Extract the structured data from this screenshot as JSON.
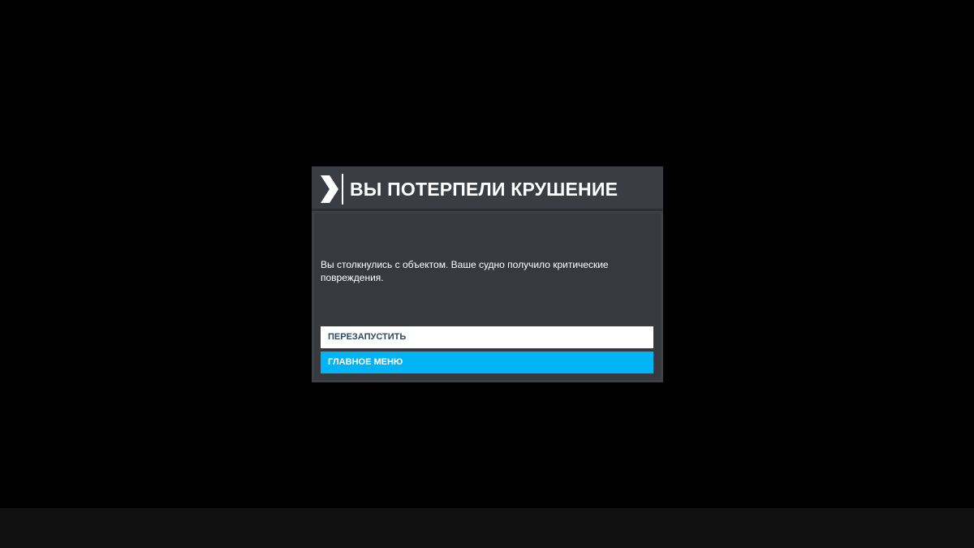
{
  "dialog": {
    "title": "ВЫ ПОТЕРПЕЛИ КРУШЕНИЕ",
    "message": "Вы столкнулись с объектом. Ваше судно получило критические повреждения.",
    "icon": "chevron-right-icon"
  },
  "buttons": {
    "restart_label": "ПЕРЕЗАПУСТИТЬ",
    "main_menu_label": "ГЛАВНОЕ МЕНЮ"
  },
  "colors": {
    "background": "#000000",
    "dialog": "#3d4146",
    "accent": "#00b4f5",
    "restart_text": "#2b4a66"
  }
}
